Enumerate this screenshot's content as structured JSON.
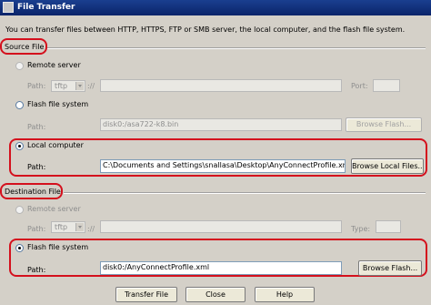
{
  "window": {
    "title": "File Transfer"
  },
  "intro": "You can transfer files between HTTP, HTTPS, FTP or SMB server, the local computer, and the flash file system.",
  "source": {
    "section_label": "Source File",
    "remote_server": {
      "label": "Remote server",
      "path_label": "Path:",
      "protocol": "tftp",
      "separator": "://",
      "path_value": "",
      "port_label": "Port:",
      "port_value": ""
    },
    "flash": {
      "label": "Flash file system",
      "path_label": "Path:",
      "path_value": "disk0:/asa722-k8.bin",
      "browse_label": "Browse Flash..."
    },
    "local": {
      "label": "Local computer",
      "path_label": "Path:",
      "path_value": "C:\\Documents and Settings\\snallasa\\Desktop\\AnyConnectProfile.xml",
      "browse_label": "Browse Local Files..."
    },
    "selected": "local"
  },
  "destination": {
    "section_label": "Destination File",
    "remote_server": {
      "label": "Remote server",
      "path_label": "Path:",
      "protocol": "tftp",
      "separator": "://",
      "path_value": "",
      "type_label": "Type:",
      "type_value": ""
    },
    "flash": {
      "label": "Flash file system",
      "path_label": "Path:",
      "path_value": "disk0:/AnyConnectProfile.xml",
      "browse_label": "Browse Flash..."
    },
    "selected": "flash"
  },
  "footer": {
    "transfer_label": "Transfer File",
    "close_label": "Close",
    "help_label": "Help"
  }
}
